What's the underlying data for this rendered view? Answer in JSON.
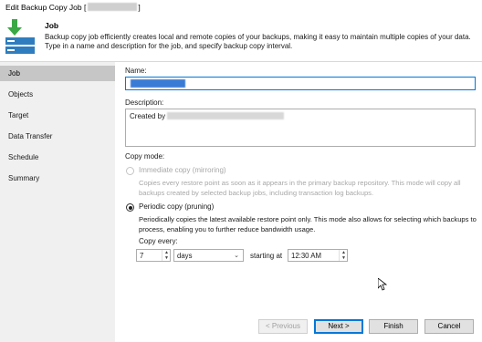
{
  "window": {
    "title_prefix": "Edit Backup Copy Job [",
    "title_suffix": "]"
  },
  "header": {
    "title": "Job",
    "description": "Backup copy job efficiently creates local and remote copies of your backups, making it easy to maintain multiple copies of your data. Type in a name and description for the job, and specify backup copy interval."
  },
  "sidebar": {
    "items": [
      {
        "label": "Job",
        "active": true
      },
      {
        "label": "Objects",
        "active": false
      },
      {
        "label": "Target",
        "active": false
      },
      {
        "label": "Data Transfer",
        "active": false
      },
      {
        "label": "Schedule",
        "active": false
      },
      {
        "label": "Summary",
        "active": false
      }
    ]
  },
  "form": {
    "name_label": "Name:",
    "description_label": "Description:",
    "description_value_prefix": "Created by",
    "copy_mode_label": "Copy mode:",
    "immediate_label": "Immediate copy (mirroring)",
    "immediate_desc": "Copies every restore point as soon as it appears in the primary backup repository. This mode will copy all backups created by selected backup jobs, including transaction log backups.",
    "periodic_label": "Periodic copy (pruning)",
    "periodic_desc": "Periodically copies the latest available restore point only. This mode also allows for selecting which backups to process, enabling you to further reduce bandwidth usage.",
    "copy_every_label": "Copy every:",
    "copy_every_value": "7",
    "unit_value": "days",
    "starting_at_label": "starting at",
    "time_value": "12:30 AM",
    "selected_mode": "periodic"
  },
  "buttons": {
    "previous": "< Previous",
    "next": "Next >",
    "finish": "Finish",
    "cancel": "Cancel"
  }
}
